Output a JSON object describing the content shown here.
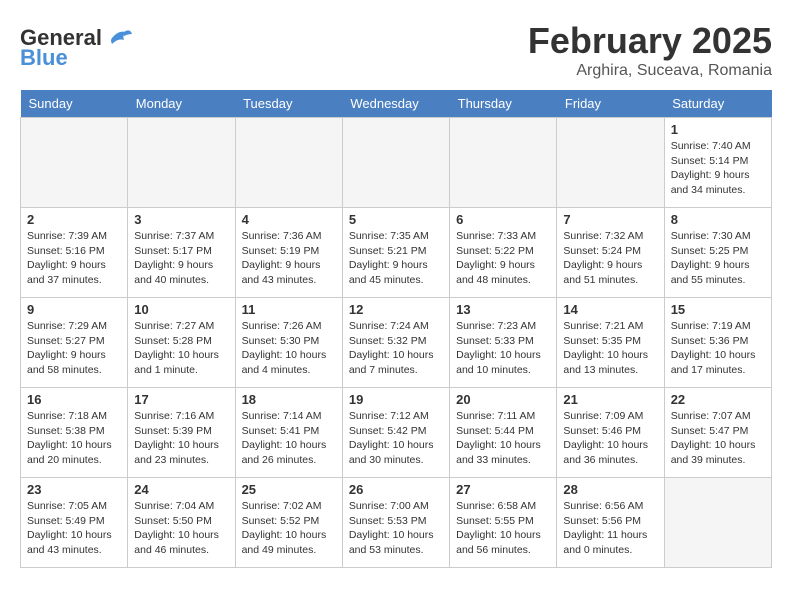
{
  "logo": {
    "general": "General",
    "blue": "Blue"
  },
  "title": {
    "month_year": "February 2025",
    "location": "Arghira, Suceava, Romania"
  },
  "days_of_week": [
    "Sunday",
    "Monday",
    "Tuesday",
    "Wednesday",
    "Thursday",
    "Friday",
    "Saturday"
  ],
  "weeks": [
    [
      {
        "day": "",
        "info": ""
      },
      {
        "day": "",
        "info": ""
      },
      {
        "day": "",
        "info": ""
      },
      {
        "day": "",
        "info": ""
      },
      {
        "day": "",
        "info": ""
      },
      {
        "day": "",
        "info": ""
      },
      {
        "day": "1",
        "info": "Sunrise: 7:40 AM\nSunset: 5:14 PM\nDaylight: 9 hours and 34 minutes."
      }
    ],
    [
      {
        "day": "2",
        "info": "Sunrise: 7:39 AM\nSunset: 5:16 PM\nDaylight: 9 hours and 37 minutes."
      },
      {
        "day": "3",
        "info": "Sunrise: 7:37 AM\nSunset: 5:17 PM\nDaylight: 9 hours and 40 minutes."
      },
      {
        "day": "4",
        "info": "Sunrise: 7:36 AM\nSunset: 5:19 PM\nDaylight: 9 hours and 43 minutes."
      },
      {
        "day": "5",
        "info": "Sunrise: 7:35 AM\nSunset: 5:21 PM\nDaylight: 9 hours and 45 minutes."
      },
      {
        "day": "6",
        "info": "Sunrise: 7:33 AM\nSunset: 5:22 PM\nDaylight: 9 hours and 48 minutes."
      },
      {
        "day": "7",
        "info": "Sunrise: 7:32 AM\nSunset: 5:24 PM\nDaylight: 9 hours and 51 minutes."
      },
      {
        "day": "8",
        "info": "Sunrise: 7:30 AM\nSunset: 5:25 PM\nDaylight: 9 hours and 55 minutes."
      }
    ],
    [
      {
        "day": "9",
        "info": "Sunrise: 7:29 AM\nSunset: 5:27 PM\nDaylight: 9 hours and 58 minutes."
      },
      {
        "day": "10",
        "info": "Sunrise: 7:27 AM\nSunset: 5:28 PM\nDaylight: 10 hours and 1 minute."
      },
      {
        "day": "11",
        "info": "Sunrise: 7:26 AM\nSunset: 5:30 PM\nDaylight: 10 hours and 4 minutes."
      },
      {
        "day": "12",
        "info": "Sunrise: 7:24 AM\nSunset: 5:32 PM\nDaylight: 10 hours and 7 minutes."
      },
      {
        "day": "13",
        "info": "Sunrise: 7:23 AM\nSunset: 5:33 PM\nDaylight: 10 hours and 10 minutes."
      },
      {
        "day": "14",
        "info": "Sunrise: 7:21 AM\nSunset: 5:35 PM\nDaylight: 10 hours and 13 minutes."
      },
      {
        "day": "15",
        "info": "Sunrise: 7:19 AM\nSunset: 5:36 PM\nDaylight: 10 hours and 17 minutes."
      }
    ],
    [
      {
        "day": "16",
        "info": "Sunrise: 7:18 AM\nSunset: 5:38 PM\nDaylight: 10 hours and 20 minutes."
      },
      {
        "day": "17",
        "info": "Sunrise: 7:16 AM\nSunset: 5:39 PM\nDaylight: 10 hours and 23 minutes."
      },
      {
        "day": "18",
        "info": "Sunrise: 7:14 AM\nSunset: 5:41 PM\nDaylight: 10 hours and 26 minutes."
      },
      {
        "day": "19",
        "info": "Sunrise: 7:12 AM\nSunset: 5:42 PM\nDaylight: 10 hours and 30 minutes."
      },
      {
        "day": "20",
        "info": "Sunrise: 7:11 AM\nSunset: 5:44 PM\nDaylight: 10 hours and 33 minutes."
      },
      {
        "day": "21",
        "info": "Sunrise: 7:09 AM\nSunset: 5:46 PM\nDaylight: 10 hours and 36 minutes."
      },
      {
        "day": "22",
        "info": "Sunrise: 7:07 AM\nSunset: 5:47 PM\nDaylight: 10 hours and 39 minutes."
      }
    ],
    [
      {
        "day": "23",
        "info": "Sunrise: 7:05 AM\nSunset: 5:49 PM\nDaylight: 10 hours and 43 minutes."
      },
      {
        "day": "24",
        "info": "Sunrise: 7:04 AM\nSunset: 5:50 PM\nDaylight: 10 hours and 46 minutes."
      },
      {
        "day": "25",
        "info": "Sunrise: 7:02 AM\nSunset: 5:52 PM\nDaylight: 10 hours and 49 minutes."
      },
      {
        "day": "26",
        "info": "Sunrise: 7:00 AM\nSunset: 5:53 PM\nDaylight: 10 hours and 53 minutes."
      },
      {
        "day": "27",
        "info": "Sunrise: 6:58 AM\nSunset: 5:55 PM\nDaylight: 10 hours and 56 minutes."
      },
      {
        "day": "28",
        "info": "Sunrise: 6:56 AM\nSunset: 5:56 PM\nDaylight: 11 hours and 0 minutes."
      },
      {
        "day": "",
        "info": ""
      }
    ]
  ]
}
